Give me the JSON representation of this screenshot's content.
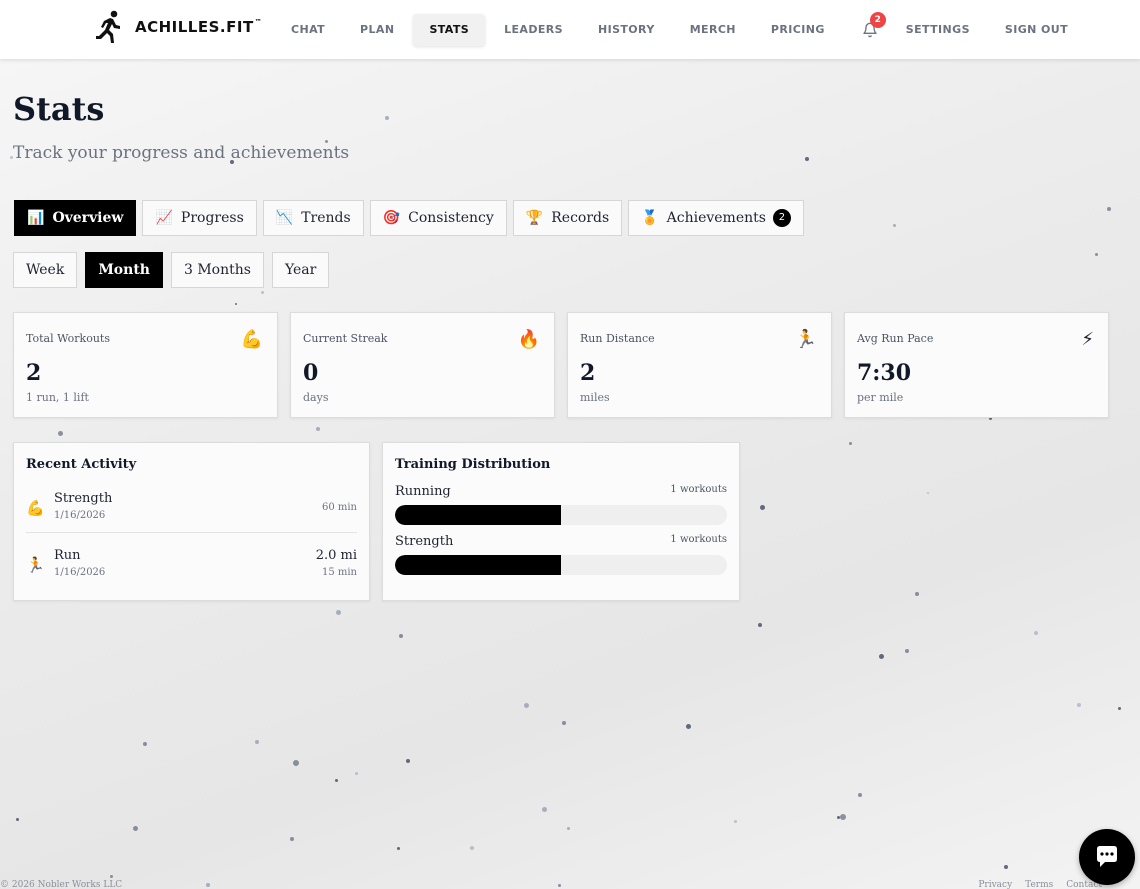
{
  "brand": {
    "name": "ACHILLES.FIT",
    "tm": "™"
  },
  "nav": {
    "items": [
      "CHAT",
      "PLAN",
      "STATS",
      "LEADERS",
      "HISTORY",
      "MERCH",
      "PRICING"
    ],
    "active": "STATS",
    "notifications_count": "2",
    "settings": "SETTINGS",
    "signout": "SIGN OUT"
  },
  "page": {
    "title": "Stats",
    "subtitle": "Track your progress and achievements"
  },
  "tabs": [
    {
      "label": "Overview",
      "icon": "📊",
      "icon_name": "bar-chart-icon"
    },
    {
      "label": "Progress",
      "icon": "📈",
      "icon_name": "trending-up-icon"
    },
    {
      "label": "Trends",
      "icon": "📉",
      "icon_name": "trending-down-icon"
    },
    {
      "label": "Consistency",
      "icon": "🎯",
      "icon_name": "target-icon"
    },
    {
      "label": "Records",
      "icon": "🏆",
      "icon_name": "trophy-icon"
    },
    {
      "label": "Achievements",
      "icon": "🏅",
      "icon_name": "medal-icon",
      "badge": "2"
    }
  ],
  "active_tab": "Overview",
  "periods": [
    "Week",
    "Month",
    "3 Months",
    "Year"
  ],
  "active_period": "Month",
  "stats": [
    {
      "label": "Total Workouts",
      "icon": "💪",
      "icon_name": "flexed-biceps-icon",
      "value": "2",
      "sub": "1 run, 1 lift"
    },
    {
      "label": "Current Streak",
      "icon": "🔥",
      "icon_name": "fire-icon",
      "value": "0",
      "sub": "days"
    },
    {
      "label": "Run Distance",
      "icon": "🏃",
      "icon_name": "runner-icon",
      "value": "2",
      "sub": "miles"
    },
    {
      "label": "Avg Run Pace",
      "icon": "⚡",
      "icon_name": "lightning-icon",
      "value": "7:30",
      "sub": "per mile"
    }
  ],
  "recent_activity": {
    "title": "Recent Activity",
    "items": [
      {
        "name": "Strength",
        "icon": "💪",
        "icon_name": "flexed-biceps-icon",
        "date": "1/16/2026",
        "value": "",
        "duration": "60 min"
      },
      {
        "name": "Run",
        "icon": "🏃",
        "icon_name": "runner-icon",
        "date": "1/16/2026",
        "value": "2.0 mi",
        "duration": "15 min"
      }
    ]
  },
  "training_distribution": {
    "title": "Training Distribution",
    "items": [
      {
        "label": "Running",
        "count": "1 workouts",
        "fraction": 0.5
      },
      {
        "label": "Strength",
        "count": "1 workouts",
        "fraction": 0.5
      }
    ]
  },
  "footer": {
    "copyright": "© 2026 Nobler Works LLC",
    "links": [
      "Privacy",
      "Terms",
      "Contact"
    ]
  },
  "colors": {
    "accent": "#000000",
    "badge": "#ef4444"
  },
  "chat_button": {
    "icon_name": "chat-bubble-icon"
  }
}
